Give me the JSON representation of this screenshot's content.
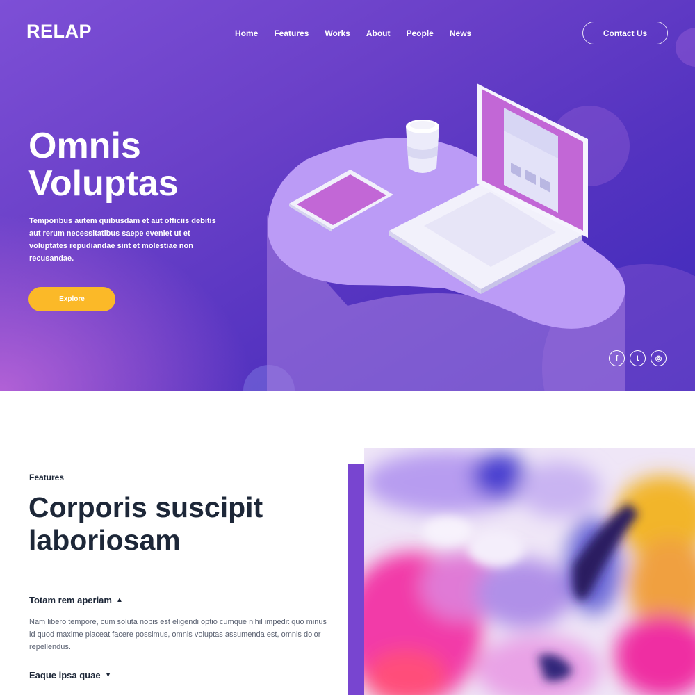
{
  "brand": {
    "logo": "RELAP"
  },
  "nav": {
    "items": [
      "Home",
      "Features",
      "Works",
      "About",
      "People",
      "News"
    ],
    "contact_label": "Contact Us"
  },
  "hero": {
    "title_line1": "Omnis",
    "title_line2": "Voluptas",
    "description": "Temporibus autem quibusdam et aut officiis debitis aut rerum necessitatibus saepe eveniet ut et voluptates repudiandae sint et molestiae non recusandae.",
    "cta_label": "Explore"
  },
  "socials": [
    {
      "icon": "facebook-icon",
      "glyph": "f"
    },
    {
      "icon": "twitter-icon",
      "glyph": "t"
    },
    {
      "icon": "instagram-icon",
      "glyph": "◎"
    }
  ],
  "features": {
    "eyebrow": "Features",
    "title_line1": "Corporis suscipit",
    "title_line2": "laboriosam",
    "accordion": [
      {
        "title": "Totam rem aperiam",
        "expanded": true,
        "body": "Nam libero tempore, cum soluta nobis est eligendi optio cumque nihil impedit quo minus id quod maxime placeat facere possimus, omnis voluptas assumenda est, omnis dolor repellendus."
      },
      {
        "title": "Eaque ipsa quae",
        "expanded": false,
        "body": ""
      }
    ]
  },
  "colors": {
    "hero_gradient_start": "#7d4fd6",
    "hero_gradient_end": "#3d29bb",
    "accent_yellow": "#fbb928",
    "dark_text": "#1d2738",
    "accent_purple": "#7845d0"
  }
}
